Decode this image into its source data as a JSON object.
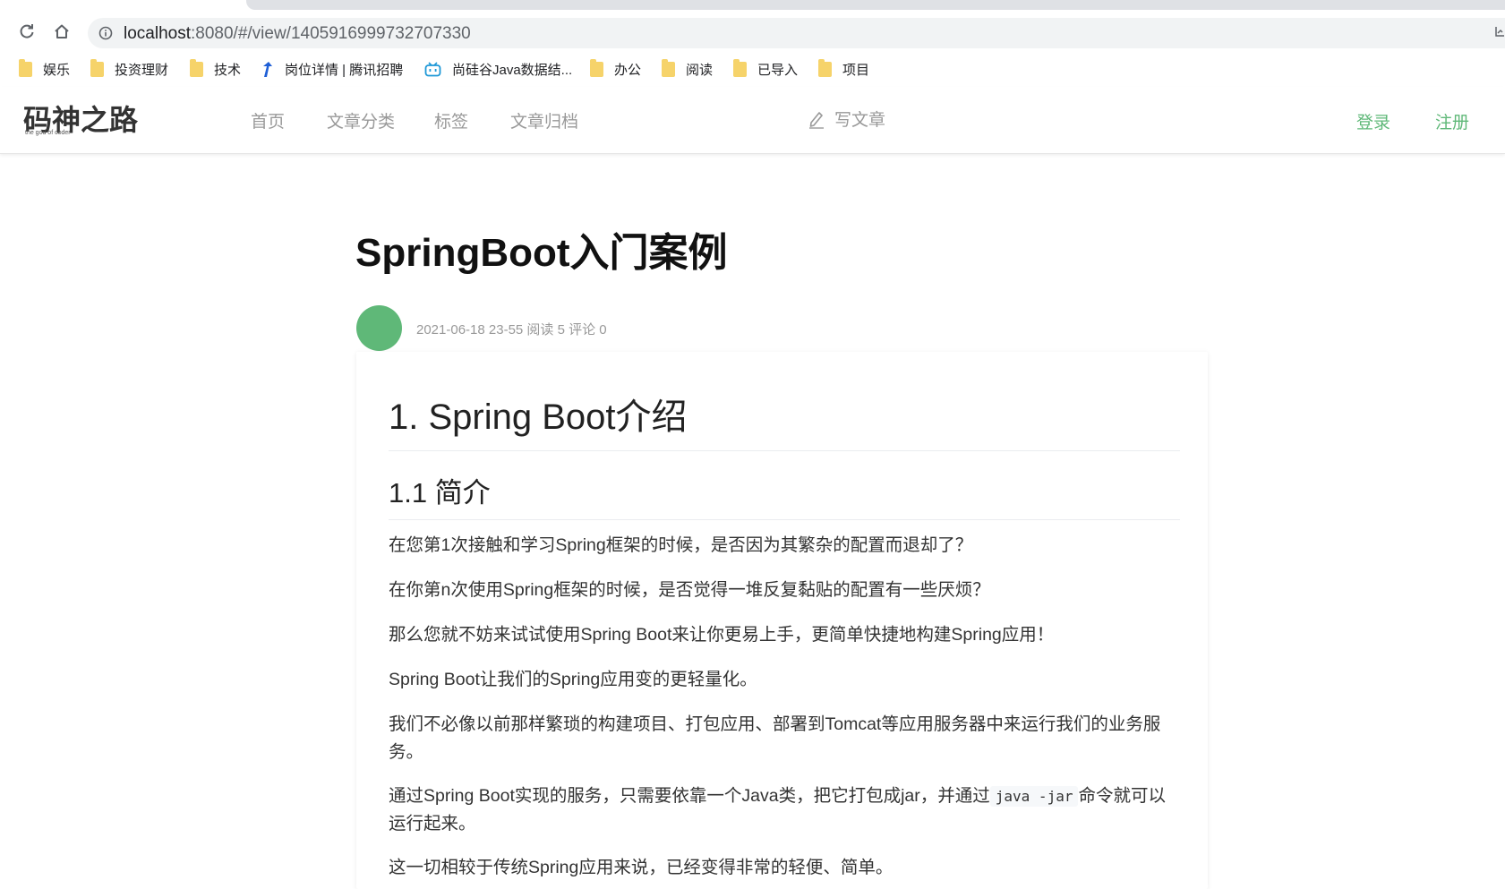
{
  "browser": {
    "url_host": "localhost",
    "url_path": ":8080/#/view/1405916999732707330",
    "bookmarks": [
      {
        "label": "娱乐",
        "icon": "folder-icon"
      },
      {
        "label": "投资理财",
        "icon": "folder-icon"
      },
      {
        "label": "技术",
        "icon": "folder-icon"
      },
      {
        "label": "岗位详情 | 腾讯招聘",
        "icon": "tencent-arrow-icon"
      },
      {
        "label": "尚硅谷Java数据结...",
        "icon": "bilibili-icon"
      },
      {
        "label": "办公",
        "icon": "folder-icon"
      },
      {
        "label": "阅读",
        "icon": "folder-icon"
      },
      {
        "label": "已导入",
        "icon": "folder-icon"
      },
      {
        "label": "项目",
        "icon": "folder-icon"
      }
    ]
  },
  "header": {
    "logo_text": "码神之路",
    "logo_sub": "the god of coder",
    "nav": [
      "首页",
      "文章分类",
      "标签",
      "文章归档"
    ],
    "write_label": "写文章",
    "login_label": "登录",
    "register_label": "注册",
    "accent_color": "#5fb878"
  },
  "article": {
    "title": "SpringBoot入门案例",
    "meta": "2021-06-18 23-55 阅读 5 评论 0",
    "h1": "1. Spring Boot介绍",
    "h2": "1.1 简介",
    "paragraphs": [
      "在您第1次接触和学习Spring框架的时候，是否因为其繁杂的配置而退却了？",
      "在你第n次使用Spring框架的时候，是否觉得一堆反复黏贴的配置有一些厌烦？",
      "那么您就不妨来试试使用Spring Boot来让你更易上手，更简单快捷地构建Spring应用！",
      "Spring Boot让我们的Spring应用变的更轻量化。",
      "我们不必像以前那样繁琐的构建项目、打包应用、部署到Tomcat等应用服务器中来运行我们的业务服务。"
    ],
    "p6_before": "通过Spring Boot实现的服务，只需要依靠一个Java类，把它打包成jar，并通过",
    "p6_code": "java -jar",
    "p6_after": "命令就可以运行起来。",
    "p7": "这一切相较于传统Spring应用来说，已经变得非常的轻便、简单。"
  }
}
